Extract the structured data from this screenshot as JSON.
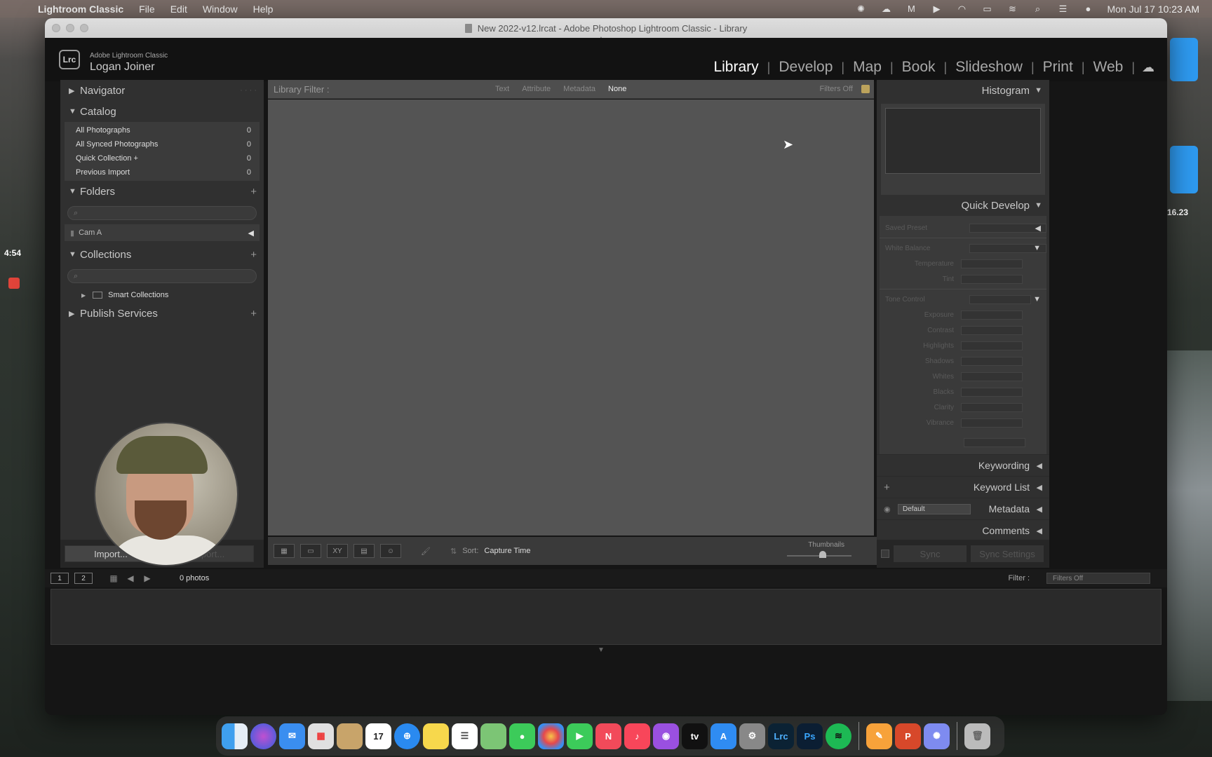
{
  "menubar": {
    "app": "Lightroom Classic",
    "items": [
      "File",
      "Edit",
      "Window",
      "Help"
    ],
    "datetime": "Mon Jul 17  10:23 AM"
  },
  "window": {
    "title": "New 2022-v12.lrcat - Adobe Photoshop Lightroom Classic - Library"
  },
  "identity": {
    "logo": "Lrc",
    "product": "Adobe Lightroom Classic",
    "user": "Logan Joiner"
  },
  "modules": [
    "Library",
    "Develop",
    "Map",
    "Book",
    "Slideshow",
    "Print",
    "Web"
  ],
  "left": {
    "navigator": "Navigator",
    "catalog": {
      "title": "Catalog",
      "rows": [
        {
          "label": "All Photographs",
          "count": "0"
        },
        {
          "label": "All Synced Photographs",
          "count": "0"
        },
        {
          "label": "Quick Collection +",
          "count": "0"
        },
        {
          "label": "Previous Import",
          "count": "0"
        }
      ]
    },
    "folders": {
      "title": "Folders",
      "volume": "Cam A"
    },
    "collections": {
      "title": "Collections",
      "smart": "Smart Collections"
    },
    "publish": "Publish Services",
    "import_label": "Import...",
    "export_label": "Export..."
  },
  "filter": {
    "label": "Library Filter :",
    "options": [
      "Text",
      "Attribute",
      "Metadata",
      "None"
    ],
    "status": "Filters Off"
  },
  "toolbar": {
    "sort_label": "Sort:",
    "sort_value": "Capture Time",
    "thumbnails_label": "Thumbnails"
  },
  "right": {
    "histogram": "Histogram",
    "quick_develop": "Quick Develop",
    "qd_rows": {
      "saved_preset": "Saved Preset",
      "white_balance": "White Balance",
      "temperature": "Temperature",
      "tint": "Tint",
      "tone_control": "Tone Control",
      "exposure": "Exposure",
      "contrast": "Contrast",
      "highlights": "Highlights",
      "shadows": "Shadows",
      "whites": "Whites",
      "blacks": "Blacks",
      "clarity": "Clarity",
      "vibrance": "Vibrance"
    },
    "keywording": "Keywording",
    "keyword_list": "Keyword List",
    "metadata": "Metadata",
    "metadata_preset": "Default",
    "comments": "Comments",
    "sync_label": "Sync",
    "sync_settings_label": "Sync Settings"
  },
  "filmstrip": {
    "monitor1": "1",
    "monitor2": "2",
    "count": "0 photos",
    "filter_label": "Filter :",
    "filter_value": "Filters Off"
  },
  "desktop": {
    "left_time": "4:54",
    "right_number": "16.23"
  }
}
